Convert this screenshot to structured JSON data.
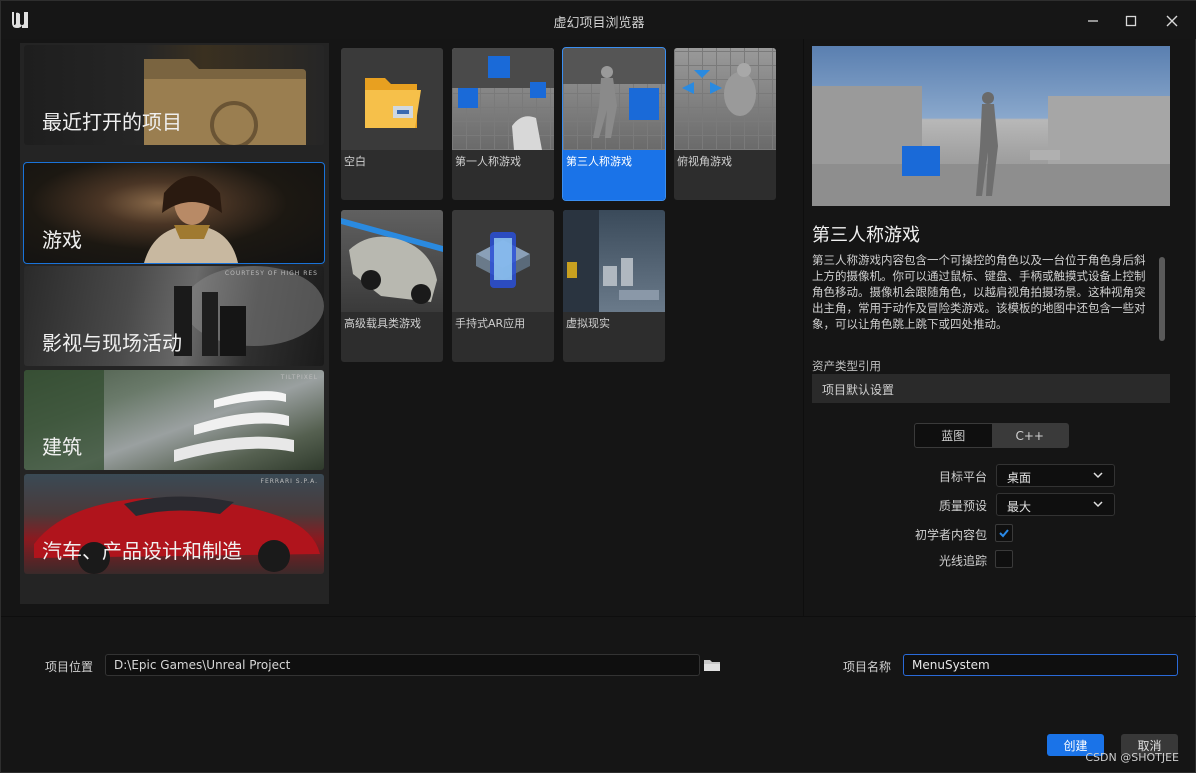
{
  "window": {
    "title": "虚幻项目浏览器"
  },
  "categories": [
    {
      "label": "最近打开的项目",
      "credit": ""
    },
    {
      "label": "游戏",
      "credit": ""
    },
    {
      "label": "影视与现场活动",
      "credit": "COURTESY OF HIGH RES"
    },
    {
      "label": "建筑",
      "credit": "TILTPIXEL"
    },
    {
      "label": "汽车、产品设计和制造",
      "credit": "FERRARI S.P.A."
    }
  ],
  "templates": [
    {
      "label": "空白",
      "icon": "folder-icon"
    },
    {
      "label": "第一人称游戏",
      "icon": "first-person-icon"
    },
    {
      "label": "第三人称游戏",
      "icon": "third-person-icon"
    },
    {
      "label": "俯视角游戏",
      "icon": "top-down-icon"
    },
    {
      "label": "高级载具类游戏",
      "icon": "vehicle-icon"
    },
    {
      "label": "手持式AR应用",
      "icon": "phone-ar-icon"
    },
    {
      "label": "虚拟现实",
      "icon": "vr-icon"
    }
  ],
  "selected_template": "第三人称游戏",
  "details": {
    "title": "第三人称游戏",
    "description": "第三人称游戏内容包含一个可操控的角色以及一台位于角色身后斜上方的摄像机。你可以通过鼠标、键盘、手柄或触摸式设备上控制角色移动。摄像机会跟随角色，以越肩视角拍摄场景。这种视角突出主角，常用于动作及冒险类游戏。该模板的地图中还包含一些对象，可以让角色跳上跳下或四处推动。",
    "asset_ref": "资产类型引用",
    "defaults_header": "项目默认设置"
  },
  "settings": {
    "mode_blueprint": "蓝图",
    "mode_cpp": "C++",
    "mode_selected": "C++",
    "target_platform_label": "目标平台",
    "target_platform_value": "桌面",
    "quality_label": "质量预设",
    "quality_value": "最大",
    "starter_content_label": "初学者内容包",
    "starter_content_checked": true,
    "raytracing_label": "光线追踪",
    "raytracing_checked": false
  },
  "project": {
    "location_label": "项目位置",
    "location_value": "D:\\Epic Games\\Unreal Project",
    "name_label": "项目名称",
    "name_value": "MenuSystem"
  },
  "buttons": {
    "create": "创建",
    "cancel": "取消"
  },
  "watermark": "CSDN @SHOTJEE",
  "colors": {
    "accent": "#1a73e8",
    "background": "#151515",
    "panel": "#242424"
  }
}
